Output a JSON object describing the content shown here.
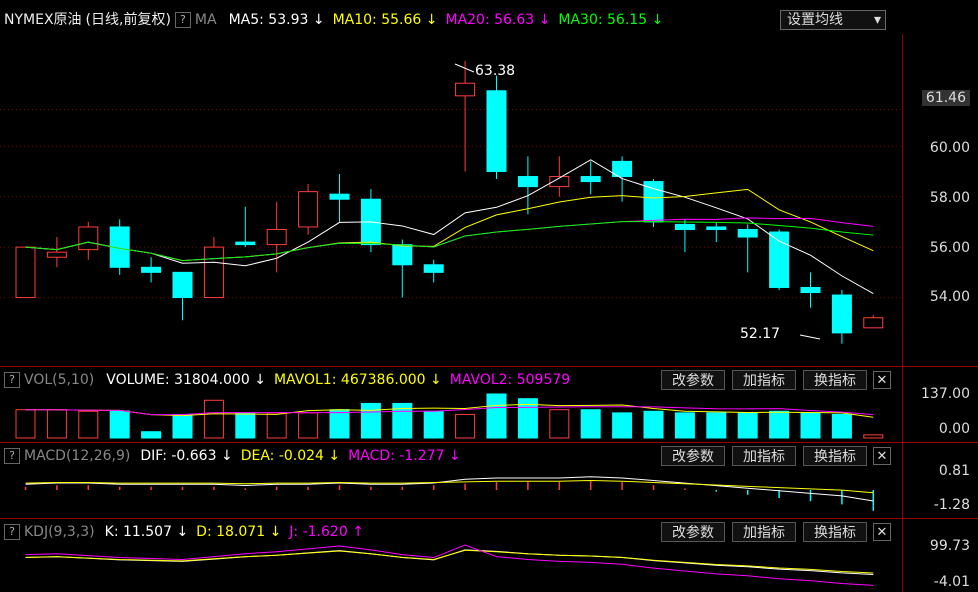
{
  "main": {
    "symbol": "NYMEX原油",
    "mode": "(日线,前复权)",
    "ma_label": "MA",
    "ma5": {
      "label": "MA5: 53.93",
      "arrow": "↓",
      "color": "#ffffff"
    },
    "ma10": {
      "label": "MA10: 55.66",
      "arrow": "↓",
      "color": "#ffff00"
    },
    "ma20": {
      "label": "MA20: 56.63",
      "arrow": "↓",
      "color": "#ff00ff"
    },
    "ma30": {
      "label": "MA30: 56.15",
      "arrow": "↓",
      "color": "#00ff00"
    },
    "ma_setting": "设置均线",
    "dropdown_icon": "▾",
    "price_labels": [
      "61.46",
      "60.00",
      "58.00",
      "56.00",
      "54.00"
    ],
    "high_label": "63.38",
    "low_label": "52.17"
  },
  "vol": {
    "name": "VOL(5,10)",
    "volume": "VOLUME: 31804.000",
    "volume_arrow": "↓",
    "mavol1": "MAVOL1: 467386.000",
    "mavol1_arrow": "↓",
    "mavol2": "MAVOL2: 509579",
    "axis": [
      "137.00",
      "0.00"
    ]
  },
  "macd": {
    "name": "MACD(12,26,9)",
    "dif": "DIF: -0.663",
    "dif_arrow": "↓",
    "dea": "DEA: -0.024",
    "dea_arrow": "↓",
    "macd": "MACD: -1.277",
    "macd_arrow": "↓",
    "axis": [
      "0.81",
      "-1.28"
    ]
  },
  "kdj": {
    "name": "KDJ(9,3,3)",
    "k": "K: 11.507",
    "k_arrow": "↓",
    "d": "D: 18.071",
    "d_arrow": "↓",
    "j": "J: -1.620",
    "j_arrow": "↑",
    "axis": [
      "99.73",
      "-4.01"
    ]
  },
  "buttons": {
    "modify": "改参数",
    "add": "加指标",
    "switch": "换指标",
    "close": "✕"
  },
  "help": "?",
  "chart_data": {
    "type": "candlestick",
    "ylim": [
      52,
      63.5
    ],
    "candles": [
      {
        "o": 54.0,
        "c": 56.0,
        "h": 56.0,
        "l": 54.0
      },
      {
        "o": 55.6,
        "c": 55.8,
        "h": 56.4,
        "l": 55.2
      },
      {
        "o": 55.9,
        "c": 56.8,
        "h": 57.0,
        "l": 55.5
      },
      {
        "o": 56.8,
        "c": 55.2,
        "h": 57.1,
        "l": 54.9
      },
      {
        "o": 55.2,
        "c": 55.0,
        "h": 55.6,
        "l": 54.6
      },
      {
        "o": 55.0,
        "c": 54.0,
        "h": 55.0,
        "l": 53.1
      },
      {
        "o": 54.0,
        "c": 56.0,
        "h": 56.4,
        "l": 54.0
      },
      {
        "o": 56.2,
        "c": 56.1,
        "h": 57.6,
        "l": 56.0
      },
      {
        "o": 56.1,
        "c": 56.7,
        "h": 57.8,
        "l": 55.0
      },
      {
        "o": 56.8,
        "c": 58.2,
        "h": 58.5,
        "l": 56.5
      },
      {
        "o": 58.1,
        "c": 57.9,
        "h": 58.9,
        "l": 57.0
      },
      {
        "o": 57.9,
        "c": 56.1,
        "h": 58.3,
        "l": 55.8
      },
      {
        "o": 56.1,
        "c": 55.3,
        "h": 56.3,
        "l": 54.0
      },
      {
        "o": 55.3,
        "c": 55.0,
        "h": 55.5,
        "l": 54.6
      },
      {
        "o": 62.0,
        "c": 62.5,
        "h": 63.38,
        "l": 59.0
      },
      {
        "o": 62.2,
        "c": 59.0,
        "h": 62.8,
        "l": 58.7
      },
      {
        "o": 58.8,
        "c": 58.4,
        "h": 59.6,
        "l": 57.3
      },
      {
        "o": 58.4,
        "c": 58.8,
        "h": 59.6,
        "l": 58.0
      },
      {
        "o": 58.8,
        "c": 58.6,
        "h": 59.4,
        "l": 58.1
      },
      {
        "o": 59.4,
        "c": 58.8,
        "h": 59.6,
        "l": 57.8
      },
      {
        "o": 58.6,
        "c": 57.0,
        "h": 58.7,
        "l": 56.8
      },
      {
        "o": 56.9,
        "c": 56.7,
        "h": 57.1,
        "l": 55.8
      },
      {
        "o": 56.8,
        "c": 56.7,
        "h": 57.0,
        "l": 56.2
      },
      {
        "o": 56.7,
        "c": 56.4,
        "h": 56.9,
        "l": 55.0
      },
      {
        "o": 56.6,
        "c": 54.4,
        "h": 56.7,
        "l": 54.3
      },
      {
        "o": 54.4,
        "c": 54.2,
        "h": 55.0,
        "l": 53.6
      },
      {
        "o": 54.1,
        "c": 52.6,
        "h": 54.3,
        "l": 52.17
      },
      {
        "o": 52.8,
        "c": 53.2,
        "h": 53.3,
        "l": 52.8
      }
    ],
    "volume": [
      90,
      90,
      85,
      86,
      20,
      75,
      120,
      80,
      80,
      80,
      90,
      110,
      110,
      85,
      75,
      140,
      125,
      90,
      90,
      80,
      85,
      80,
      80,
      80,
      85,
      80,
      75,
      10
    ],
    "macd_hist": [
      0.2,
      0.3,
      0.3,
      0.2,
      0.2,
      0.2,
      0.2,
      0.1,
      0.2,
      0.2,
      0.3,
      0.2,
      0.2,
      0.3,
      0.4,
      0.5,
      0.5,
      0.5,
      0.6,
      0.5,
      0.3,
      0.1,
      -0.1,
      -0.3,
      -0.5,
      -0.7,
      -0.9,
      -1.3
    ]
  }
}
